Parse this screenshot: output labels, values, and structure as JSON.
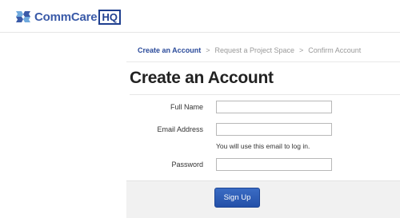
{
  "brand": {
    "name": "CommCare",
    "suffix": "HQ"
  },
  "breadcrumb": {
    "items": [
      "Create an Account",
      "Request a Project Space",
      "Confirm Account"
    ],
    "separator": ">"
  },
  "page": {
    "title": "Create an Account"
  },
  "form": {
    "full_name_label": "Full Name",
    "full_name_value": "",
    "email_label": "Email Address",
    "email_value": "",
    "email_help": "You will use this email to log in.",
    "password_label": "Password",
    "password_value": ""
  },
  "actions": {
    "signup_label": "Sign Up"
  },
  "colors": {
    "brand_blue": "#3a5aa8",
    "button_blue": "#2d5db8",
    "breadcrumb_active": "#2a4a9a"
  }
}
